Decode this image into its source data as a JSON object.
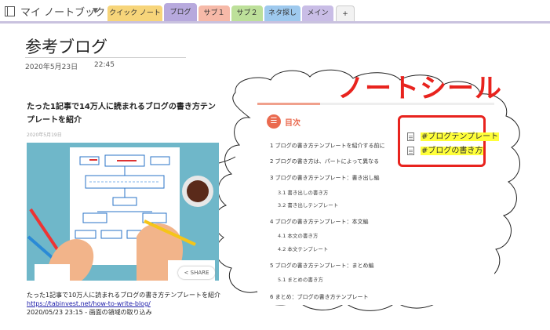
{
  "notebook": {
    "title": "マイ ノートブック",
    "caret": "▼"
  },
  "tabs": [
    {
      "label": "クイック ノート",
      "color": "#f7d57a",
      "active": false
    },
    {
      "label": "ブログ",
      "color": "#b7a9dd",
      "active": true
    },
    {
      "label": "サブ１",
      "color": "#f6b9a8",
      "active": false
    },
    {
      "label": "サブ２",
      "color": "#bde09a",
      "active": false
    },
    {
      "label": "ネタ探し",
      "color": "#9ec9ee",
      "active": false
    },
    {
      "label": "メイン",
      "color": "#c9bde6",
      "active": false
    },
    {
      "label": "+",
      "color": "#f2f2f2",
      "active": false
    }
  ],
  "page": {
    "title": "参考ブログ",
    "date": "2020年5月23日",
    "time": "22:45"
  },
  "article": {
    "title": "たった1記事で14万人に読まれるブログの書き方テンプレートを紹介",
    "date": "2020年5月19日",
    "share_label": "SHARE",
    "caption_line1": "たった1記事で10万人に読まれるブログの書き方テンプレートを紹介",
    "caption_link": "https://tabinvest.net/how-to-write-blog/",
    "caption_line3": "2020/05/23 23:15 - 画面の領域の取り込み"
  },
  "sticker_label": "ノートシール",
  "toc": {
    "heading": "目次",
    "icon": "list-icon",
    "items": [
      {
        "text": "1 ブログの書き方テンプレートを紹介する前に",
        "level": 1
      },
      {
        "text": "2 ブログの書き方は、パートによって異なる",
        "level": 1
      },
      {
        "text": "3 ブログの書き方テンプレート：書き出し編",
        "level": 1
      },
      {
        "text": "3.1 書き出しの書き方",
        "level": 2
      },
      {
        "text": "3.2 書き出しテンプレート",
        "level": 2
      },
      {
        "text": "4 ブログの書き方テンプレート：本文編",
        "level": 1
      },
      {
        "text": "4.1 本文の書き方",
        "level": 2
      },
      {
        "text": "4.2 本文テンプレート",
        "level": 2
      },
      {
        "text": "5 ブログの書き方テンプレート：まとめ編",
        "level": 1
      },
      {
        "text": "5.1 まとめの書き方",
        "level": 2
      },
      {
        "text": "6 まとめ：ブログの書き方テンプレート",
        "level": 1
      }
    ]
  },
  "tags": [
    {
      "text": "#ブログテンプレート",
      "icon": "document-icon"
    },
    {
      "text": "#ブログの書き方",
      "icon": "document-icon"
    }
  ],
  "colors": {
    "accent_red": "#e8231e",
    "toc_orange": "#ea6a4f",
    "highlight": "#ffff3a",
    "link": "#1a1aa8"
  }
}
